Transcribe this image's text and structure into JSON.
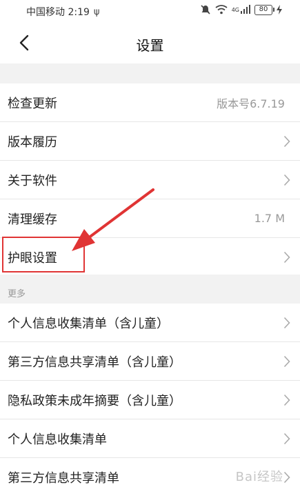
{
  "status_bar": {
    "carrier_time": "中国移动 2:19",
    "battery": "80",
    "network": "4G"
  },
  "header": {
    "title": "设置"
  },
  "main_list": [
    {
      "label": "检查更新",
      "value": "版本号6.7.19"
    },
    {
      "label": "版本履历"
    },
    {
      "label": "关于软件"
    },
    {
      "label": "清理缓存",
      "value": "1.7 M"
    },
    {
      "label": "护眼设置"
    }
  ],
  "more_section": {
    "header": "更多",
    "items": [
      {
        "label": "个人信息收集清单（含儿童）"
      },
      {
        "label": "第三方信息共享清单（含儿童）"
      },
      {
        "label": "隐私政策未成年摘要（含儿童）"
      },
      {
        "label": "个人信息收集清单"
      },
      {
        "label": "第三方信息共享清单"
      }
    ]
  },
  "watermark": "Bai经验",
  "colors": {
    "annotation": "#e03434",
    "background": "#f2f2f2",
    "secondary_text": "#999999"
  }
}
